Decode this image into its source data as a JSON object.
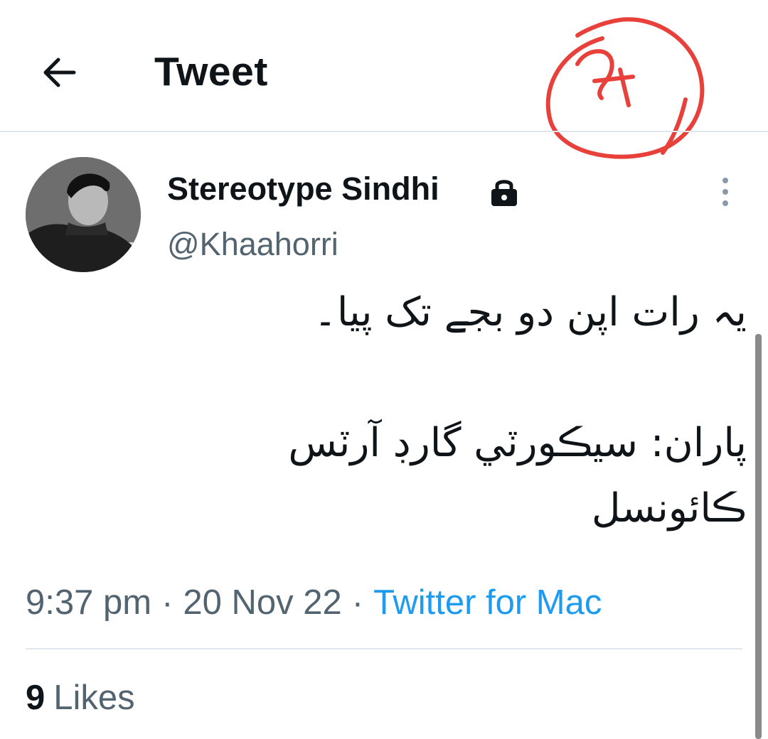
{
  "header": {
    "title": "Tweet",
    "back_icon": "arrow-left-icon"
  },
  "annotation": {
    "color": "#e8413c",
    "kind": "hand-drawn circle with scribbled digit"
  },
  "tweet": {
    "author": {
      "display_name": "Stereotype Sindhi",
      "handle": "@Khaahorri",
      "protected_icon": "lock-icon"
    },
    "text": "یہ رات اپن دو بجے تک پیا۔\n\nپاران: سيڪورٽي گارڊ آرٽس ڪائونسل",
    "time": "9:37 pm",
    "separator": "·",
    "date": "20 Nov 22",
    "source": "Twitter for Mac",
    "likes_count": "9",
    "likes_label": "Likes"
  },
  "colors": {
    "text_primary": "#0f1419",
    "text_secondary": "#536471",
    "link": "#1d9bf0",
    "divider": "#e1e8ed"
  }
}
